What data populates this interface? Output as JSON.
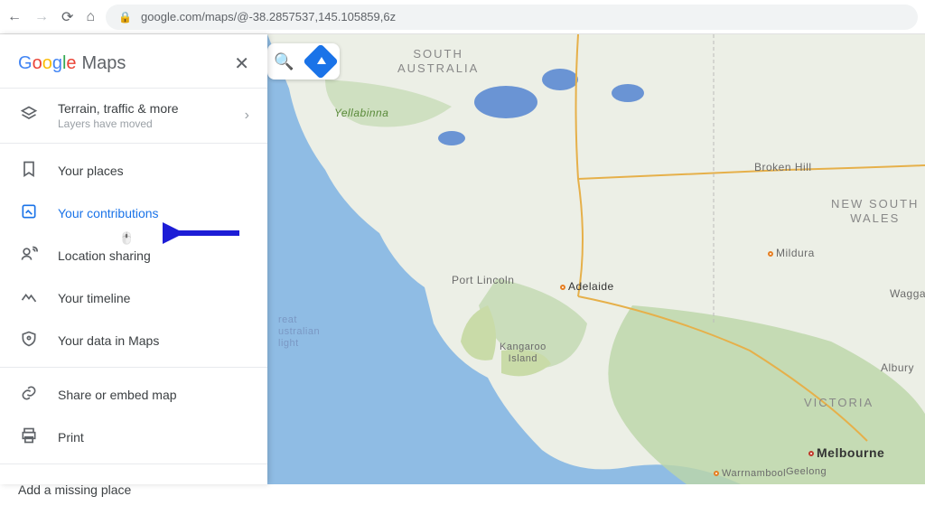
{
  "browser": {
    "url": "google.com/maps/@-38.2857537,145.105859,6z"
  },
  "logo": {
    "maps": "Maps"
  },
  "layers": {
    "title": "Terrain, traffic & more",
    "subtitle": "Layers have moved"
  },
  "menu": {
    "places": "Your places",
    "contributions": "Your contributions",
    "location_sharing": "Location sharing",
    "timeline": "Your timeline",
    "data": "Your data in Maps",
    "share": "Share or embed map",
    "print": "Print"
  },
  "add_place": "Add a missing place",
  "map_labels": {
    "south_australia": "SOUTH\nAUSTRALIA",
    "nsw": "NEW SOUTH\nWALES",
    "victoria": "VICTORIA",
    "yellabinna": "Yellabinna",
    "broken_hill": "Broken Hill",
    "mildura": "Mildura",
    "wagga": "Wagga",
    "port_lincoln": "Port Lincoln",
    "adelaide": "Adelaide",
    "kangaroo": "Kangaroo\nIsland",
    "albury": "Albury",
    "warrnambool": "Warrnambool",
    "geelong": "Geelong",
    "melbourne": "Melbourne",
    "bight": "reat\nustralian\nlight"
  }
}
